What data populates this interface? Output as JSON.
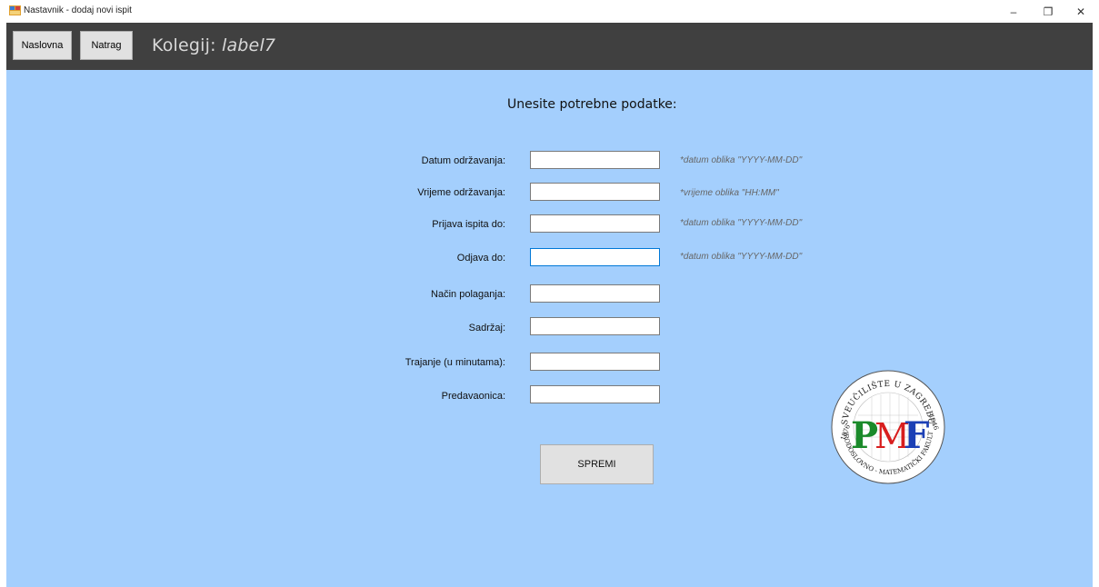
{
  "window": {
    "title": "Nastavnik - dodaj novi ispit",
    "controls": {
      "minimize": "–",
      "maximize": "❐",
      "close": "✕"
    }
  },
  "header": {
    "home_button": "Naslovna",
    "back_button": "Natrag",
    "title_prefix": "Kolegij: ",
    "title_value": "label7"
  },
  "form": {
    "heading": "Unesite potrebne podatke:",
    "fields": [
      {
        "label": "Datum održavanja:",
        "value": "",
        "hint": "*datum oblika \"YYYY-MM-DD\""
      },
      {
        "label": "Vrijeme održavanja:",
        "value": "",
        "hint": "*vrijeme oblika \"HH:MM\""
      },
      {
        "label": "Prijava ispita do:",
        "value": "",
        "hint": "*datum oblika \"YYYY-MM-DD\""
      },
      {
        "label": "Odjava do:",
        "value": "",
        "hint": "*datum oblika \"YYYY-MM-DD\""
      },
      {
        "label": "Način polaganja:",
        "value": ""
      },
      {
        "label": "Sadržaj:",
        "value": ""
      },
      {
        "label": "Trajanje (u minutama):",
        "value": ""
      },
      {
        "label": "Predavaonica:",
        "value": ""
      }
    ],
    "save_button": "SPREMI"
  },
  "logo": {
    "letters": [
      "P",
      "M",
      "F"
    ],
    "ring_text": "SVEUČILIŠTE U ZAGREBU",
    "bottom_text": "PRIRODOSLOVNO - MATEMATIČKI FAKULTET",
    "year_left": "1876",
    "year_right": "1946",
    "colors": {
      "P": "#1a8a2a",
      "M": "#d81e1e",
      "F": "#1b3fb5"
    }
  },
  "colors": {
    "background": "#a4cffd",
    "header": "#404040",
    "focus_border": "#0078d7"
  }
}
